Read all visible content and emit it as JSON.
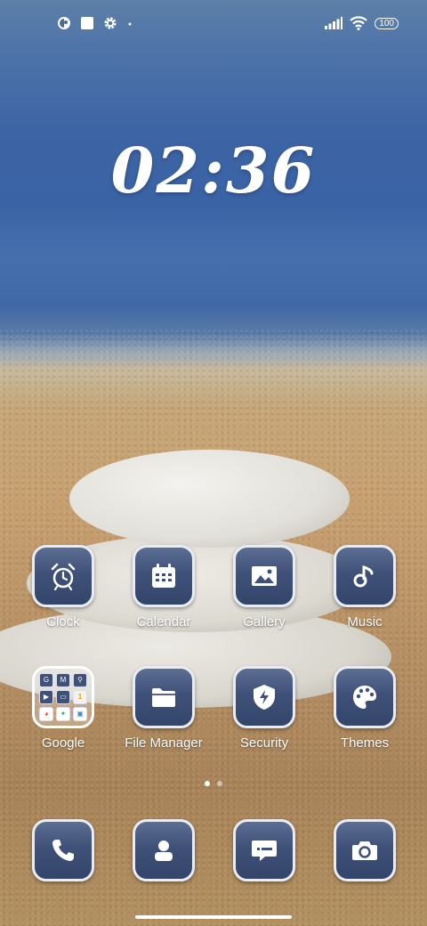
{
  "status_bar": {
    "left_icons": [
      "app-notification-icon",
      "square-notification-icon",
      "settings-gear-icon",
      "more-dot-icon"
    ],
    "battery": "100",
    "right_icons": [
      "signal-icon",
      "wifi-icon",
      "battery-icon"
    ]
  },
  "clock": {
    "time": "02:36"
  },
  "apps_row1": [
    {
      "label": "Clock",
      "icon": "alarm-clock-icon"
    },
    {
      "label": "Calendar",
      "icon": "calendar-icon"
    },
    {
      "label": "Gallery",
      "icon": "image-icon"
    },
    {
      "label": "Music",
      "icon": "music-note-icon"
    }
  ],
  "apps_row2": [
    {
      "label": "Google",
      "icon": "google-folder-icon",
      "folder_apps": [
        "G",
        "M",
        "⚲",
        "▶",
        "▭",
        "1",
        "◕",
        "✦",
        "▣"
      ]
    },
    {
      "label": "File Manager",
      "icon": "folder-icon"
    },
    {
      "label": "Security",
      "icon": "shield-bolt-icon"
    },
    {
      "label": "Themes",
      "icon": "palette-icon"
    }
  ],
  "dock": [
    {
      "icon": "phone-icon"
    },
    {
      "icon": "contacts-icon"
    },
    {
      "icon": "messages-icon"
    },
    {
      "icon": "camera-icon"
    }
  ],
  "pages": {
    "count": 2,
    "current": 1
  }
}
